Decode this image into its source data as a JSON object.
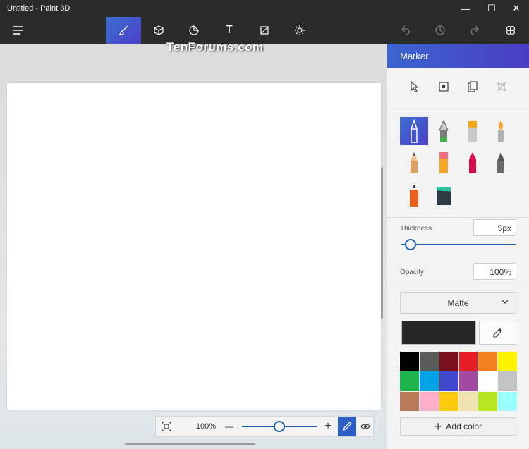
{
  "window": {
    "title": "Untitled - Paint 3D",
    "minimize_glyph": "—",
    "maximize_glyph": "☐",
    "close_glyph": "✕"
  },
  "watermark": "TenForums.com",
  "toolbar": {
    "menu_icon": "hamburger-icon",
    "tools": [
      "brushes-icon",
      "3d-shapes-icon",
      "stickers-icon",
      "text-icon",
      "canvas-icon",
      "effects-icon"
    ],
    "active_tool": "brushes-icon",
    "right_actions": [
      "undo-icon",
      "history-icon",
      "redo-icon",
      "remix3d-icon"
    ],
    "text_tool_glyph": "T"
  },
  "zoom": {
    "value": "100%",
    "minus": "—",
    "plus": "+",
    "slider_level_percent": 50
  },
  "panel": {
    "title": "Marker",
    "select_tools": [
      "select-icon",
      "magic-select-icon",
      "paste-icon",
      "crop-icon"
    ],
    "brushes": [
      "marker",
      "calligraphy-pen",
      "oil-brush",
      "watercolor",
      "pencil",
      "eraser",
      "crayon",
      "pixel-pen",
      "spray-can",
      "fill"
    ],
    "active_brush": "marker",
    "thickness_label": "Thickness",
    "thickness_value": "5px",
    "opacity_label": "Opacity",
    "opacity_value": "100%",
    "finish": "Matte",
    "current_color": "#262626",
    "palette": [
      "#000000",
      "#5a5a5a",
      "#7c0f1c",
      "#e81c24",
      "#f47f20",
      "#fef200",
      "#1fb34b",
      "#00a2e8",
      "#3f48cc",
      "#a349a4",
      "#ffffff",
      "#c3c3c3",
      "#b97a57",
      "#ffaec9",
      "#ffc90e",
      "#efe4b0",
      "#b5e61d",
      "#99ffff"
    ],
    "add_color_label": "Add color",
    "add_color_glyph": "+"
  },
  "colors": {
    "accent": "#3a64d0",
    "slider": "#1f5fa8"
  }
}
